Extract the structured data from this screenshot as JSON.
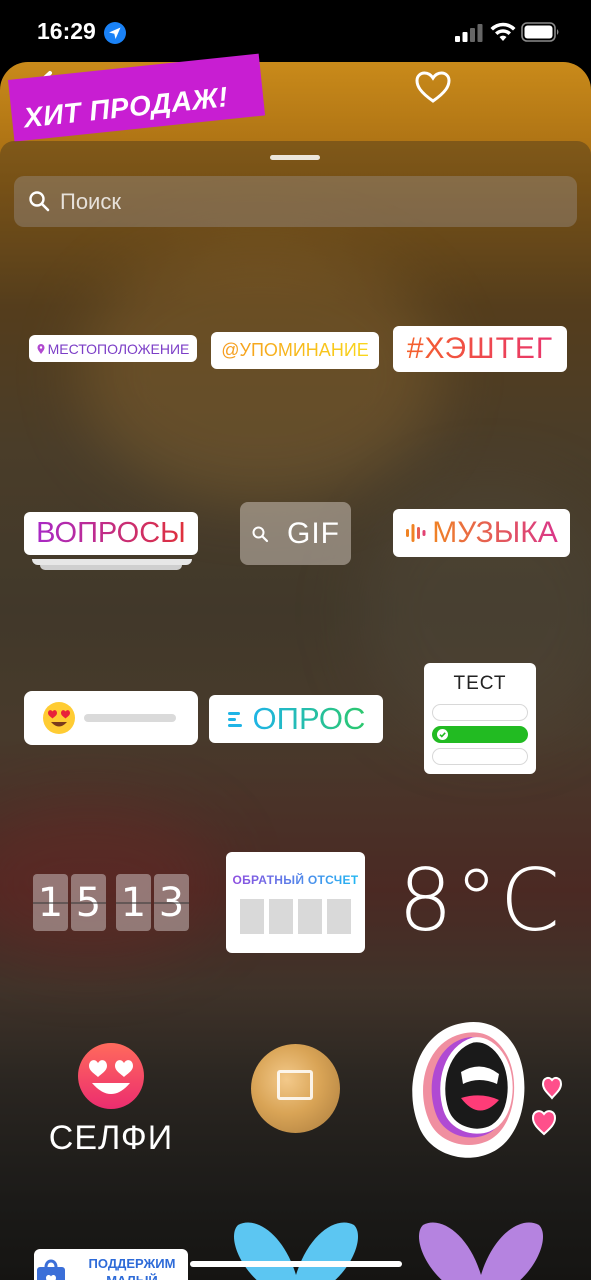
{
  "status_bar": {
    "time": "16:29"
  },
  "story": {
    "promo_text": "ХИТ ПРОДАЖ!"
  },
  "search": {
    "placeholder": "Поиск"
  },
  "stickers": {
    "location": "МЕСТОПОЛОЖЕНИЕ",
    "mention": "@УПОМИНАНИЕ",
    "hashtag": "#ХЭШТЕГ",
    "questions": "ВОПРОСЫ",
    "gif": "GIF",
    "music": "МУЗЫКА",
    "poll": "ОПРОС",
    "quiz": "ТЕСТ",
    "clock_hours": [
      "1",
      "5"
    ],
    "clock_minutes": [
      "1",
      "3"
    ],
    "countdown": "ОБРАТНЫЙ ОТСЧЕТ",
    "temperature": "8°C",
    "selfie": "СЕЛФИ",
    "support_small_business": "ПОДДЕРЖИМ МАЛЫЙ БИЗНЕС"
  },
  "colors": {
    "promo_banner": "#c81ed2",
    "quiz_correct": "#22bb22",
    "support_text": "#2e6bd8",
    "butterfly_blue": "#5cc6f2",
    "butterfly_purple": "#b583e0"
  }
}
